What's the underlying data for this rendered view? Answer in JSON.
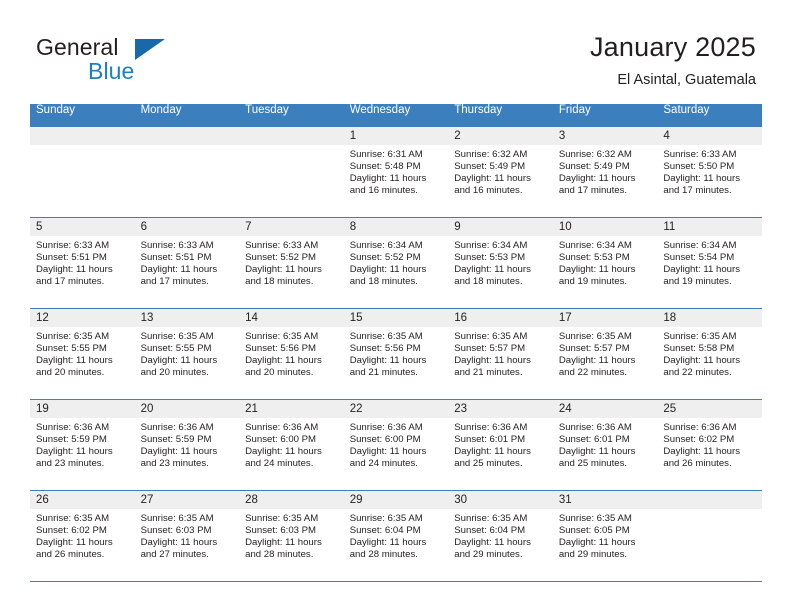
{
  "brand": {
    "name_part1": "General",
    "name_part2": "Blue",
    "logo_icon": "triangle-logo-icon",
    "accent_color": "#1769aa",
    "text_color": "#231f20"
  },
  "header": {
    "title": "January 2025",
    "subtitle": "El Asintal, Guatemala"
  },
  "theme": {
    "header_row_bg": "#3b7fbe",
    "header_row_text": "#ffffff",
    "daynum_band_bg": "#efefef",
    "cell_bg": "#ffffff",
    "grid_line": "#3b7fbe"
  },
  "calendar": {
    "day_names": [
      "Sunday",
      "Monday",
      "Tuesday",
      "Wednesday",
      "Thursday",
      "Friday",
      "Saturday"
    ],
    "weeks": [
      [
        {
          "day": "",
          "lines": []
        },
        {
          "day": "",
          "lines": []
        },
        {
          "day": "",
          "lines": []
        },
        {
          "day": "1",
          "lines": [
            "Sunrise: 6:31 AM",
            "Sunset: 5:48 PM",
            "Daylight: 11 hours",
            "and 16 minutes."
          ]
        },
        {
          "day": "2",
          "lines": [
            "Sunrise: 6:32 AM",
            "Sunset: 5:49 PM",
            "Daylight: 11 hours",
            "and 16 minutes."
          ]
        },
        {
          "day": "3",
          "lines": [
            "Sunrise: 6:32 AM",
            "Sunset: 5:49 PM",
            "Daylight: 11 hours",
            "and 17 minutes."
          ]
        },
        {
          "day": "4",
          "lines": [
            "Sunrise: 6:33 AM",
            "Sunset: 5:50 PM",
            "Daylight: 11 hours",
            "and 17 minutes."
          ]
        }
      ],
      [
        {
          "day": "5",
          "lines": [
            "Sunrise: 6:33 AM",
            "Sunset: 5:51 PM",
            "Daylight: 11 hours",
            "and 17 minutes."
          ]
        },
        {
          "day": "6",
          "lines": [
            "Sunrise: 6:33 AM",
            "Sunset: 5:51 PM",
            "Daylight: 11 hours",
            "and 17 minutes."
          ]
        },
        {
          "day": "7",
          "lines": [
            "Sunrise: 6:33 AM",
            "Sunset: 5:52 PM",
            "Daylight: 11 hours",
            "and 18 minutes."
          ]
        },
        {
          "day": "8",
          "lines": [
            "Sunrise: 6:34 AM",
            "Sunset: 5:52 PM",
            "Daylight: 11 hours",
            "and 18 minutes."
          ]
        },
        {
          "day": "9",
          "lines": [
            "Sunrise: 6:34 AM",
            "Sunset: 5:53 PM",
            "Daylight: 11 hours",
            "and 18 minutes."
          ]
        },
        {
          "day": "10",
          "lines": [
            "Sunrise: 6:34 AM",
            "Sunset: 5:53 PM",
            "Daylight: 11 hours",
            "and 19 minutes."
          ]
        },
        {
          "day": "11",
          "lines": [
            "Sunrise: 6:34 AM",
            "Sunset: 5:54 PM",
            "Daylight: 11 hours",
            "and 19 minutes."
          ]
        }
      ],
      [
        {
          "day": "12",
          "lines": [
            "Sunrise: 6:35 AM",
            "Sunset: 5:55 PM",
            "Daylight: 11 hours",
            "and 20 minutes."
          ]
        },
        {
          "day": "13",
          "lines": [
            "Sunrise: 6:35 AM",
            "Sunset: 5:55 PM",
            "Daylight: 11 hours",
            "and 20 minutes."
          ]
        },
        {
          "day": "14",
          "lines": [
            "Sunrise: 6:35 AM",
            "Sunset: 5:56 PM",
            "Daylight: 11 hours",
            "and 20 minutes."
          ]
        },
        {
          "day": "15",
          "lines": [
            "Sunrise: 6:35 AM",
            "Sunset: 5:56 PM",
            "Daylight: 11 hours",
            "and 21 minutes."
          ]
        },
        {
          "day": "16",
          "lines": [
            "Sunrise: 6:35 AM",
            "Sunset: 5:57 PM",
            "Daylight: 11 hours",
            "and 21 minutes."
          ]
        },
        {
          "day": "17",
          "lines": [
            "Sunrise: 6:35 AM",
            "Sunset: 5:57 PM",
            "Daylight: 11 hours",
            "and 22 minutes."
          ]
        },
        {
          "day": "18",
          "lines": [
            "Sunrise: 6:35 AM",
            "Sunset: 5:58 PM",
            "Daylight: 11 hours",
            "and 22 minutes."
          ]
        }
      ],
      [
        {
          "day": "19",
          "lines": [
            "Sunrise: 6:36 AM",
            "Sunset: 5:59 PM",
            "Daylight: 11 hours",
            "and 23 minutes."
          ]
        },
        {
          "day": "20",
          "lines": [
            "Sunrise: 6:36 AM",
            "Sunset: 5:59 PM",
            "Daylight: 11 hours",
            "and 23 minutes."
          ]
        },
        {
          "day": "21",
          "lines": [
            "Sunrise: 6:36 AM",
            "Sunset: 6:00 PM",
            "Daylight: 11 hours",
            "and 24 minutes."
          ]
        },
        {
          "day": "22",
          "lines": [
            "Sunrise: 6:36 AM",
            "Sunset: 6:00 PM",
            "Daylight: 11 hours",
            "and 24 minutes."
          ]
        },
        {
          "day": "23",
          "lines": [
            "Sunrise: 6:36 AM",
            "Sunset: 6:01 PM",
            "Daylight: 11 hours",
            "and 25 minutes."
          ]
        },
        {
          "day": "24",
          "lines": [
            "Sunrise: 6:36 AM",
            "Sunset: 6:01 PM",
            "Daylight: 11 hours",
            "and 25 minutes."
          ]
        },
        {
          "day": "25",
          "lines": [
            "Sunrise: 6:36 AM",
            "Sunset: 6:02 PM",
            "Daylight: 11 hours",
            "and 26 minutes."
          ]
        }
      ],
      [
        {
          "day": "26",
          "lines": [
            "Sunrise: 6:35 AM",
            "Sunset: 6:02 PM",
            "Daylight: 11 hours",
            "and 26 minutes."
          ]
        },
        {
          "day": "27",
          "lines": [
            "Sunrise: 6:35 AM",
            "Sunset: 6:03 PM",
            "Daylight: 11 hours",
            "and 27 minutes."
          ]
        },
        {
          "day": "28",
          "lines": [
            "Sunrise: 6:35 AM",
            "Sunset: 6:03 PM",
            "Daylight: 11 hours",
            "and 28 minutes."
          ]
        },
        {
          "day": "29",
          "lines": [
            "Sunrise: 6:35 AM",
            "Sunset: 6:04 PM",
            "Daylight: 11 hours",
            "and 28 minutes."
          ]
        },
        {
          "day": "30",
          "lines": [
            "Sunrise: 6:35 AM",
            "Sunset: 6:04 PM",
            "Daylight: 11 hours",
            "and 29 minutes."
          ]
        },
        {
          "day": "31",
          "lines": [
            "Sunrise: 6:35 AM",
            "Sunset: 6:05 PM",
            "Daylight: 11 hours",
            "and 29 minutes."
          ]
        },
        {
          "day": "",
          "lines": []
        }
      ]
    ]
  }
}
